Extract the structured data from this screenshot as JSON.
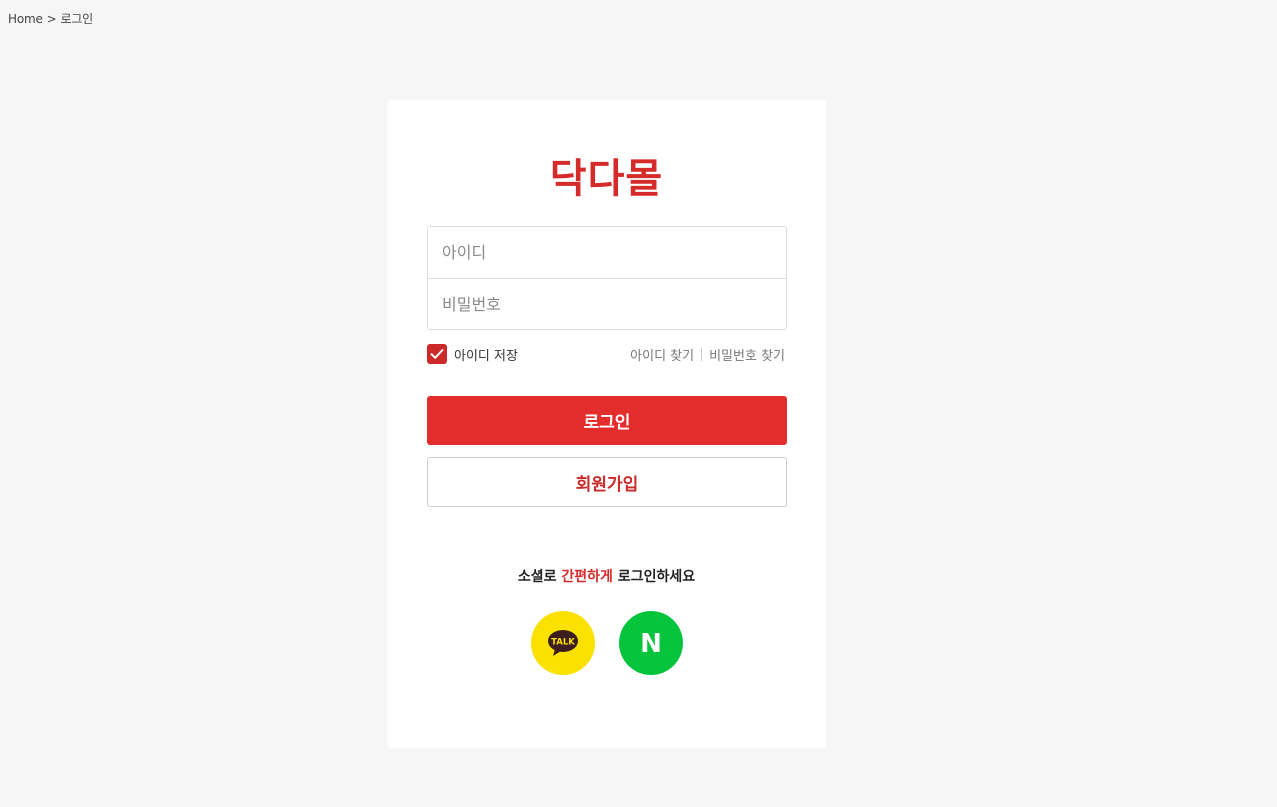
{
  "breadcrumb": {
    "home": "Home",
    "separator": ">",
    "current": "로그인"
  },
  "logo": {
    "text": "닥다몰"
  },
  "login_form": {
    "id_placeholder": "아이디",
    "password_placeholder": "비밀번호",
    "remember_label": "아이디 저장",
    "remember_checked": true,
    "find_id": "아이디 찾기",
    "find_password": "비밀번호 찾기",
    "login_button": "로그인",
    "join_button": "회원가입"
  },
  "social": {
    "text_prefix": "소셜로 ",
    "text_accent": "간편하게",
    "text_suffix": " 로그인하세요",
    "kakao_icon_text": "TALK",
    "naver_icon_text": "N"
  },
  "colors": {
    "brand": "#d62b2b",
    "login_button": "#e32d2d",
    "kakao": "#fae100",
    "naver": "#06c43b",
    "background": "#f6f6f6"
  },
  "icons": {
    "checkbox": "check-icon",
    "kakao": "kakao-talk-icon",
    "naver": "naver-icon"
  }
}
